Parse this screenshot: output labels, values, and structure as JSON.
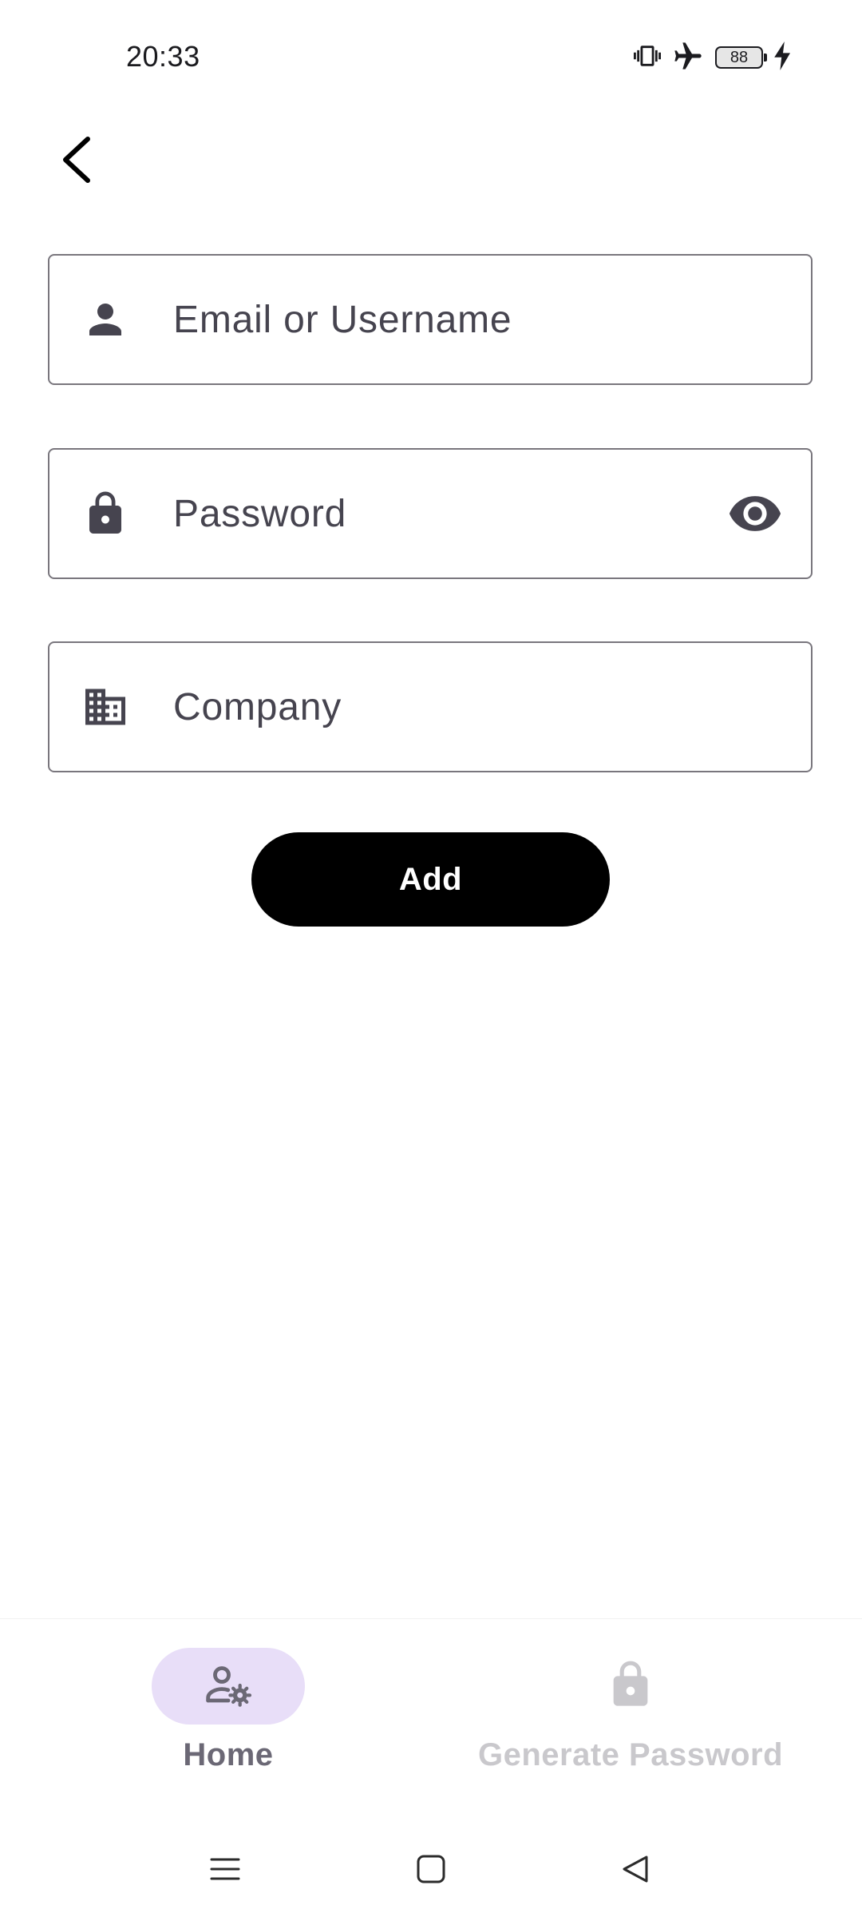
{
  "status_bar": {
    "time": "20:33",
    "battery_level": "88",
    "icons": [
      "vibrate-icon",
      "airplane-icon",
      "battery-icon",
      "charging-icon"
    ]
  },
  "header": {
    "back_icon": "chevron-left-icon"
  },
  "form": {
    "email": {
      "placeholder": "Email or Username",
      "value": "",
      "icon": "person-icon"
    },
    "password": {
      "placeholder": "Password",
      "value": "",
      "icon": "lock-icon",
      "toggle_icon": "eye-icon"
    },
    "company": {
      "placeholder": "Company",
      "value": "",
      "icon": "building-icon"
    },
    "submit_label": "Add"
  },
  "bottom_nav": {
    "items": [
      {
        "label": "Home",
        "icon": "user-settings-icon",
        "selected": true
      },
      {
        "label": "Generate Password",
        "icon": "lock-icon",
        "selected": false
      }
    ]
  },
  "system_nav": {
    "icons": [
      "menu-icon",
      "home-square-icon",
      "back-triangle-icon"
    ]
  },
  "colors": {
    "nav_pill": "#e8def8",
    "button_bg": "#000000",
    "field_border": "#79767d",
    "icon": "#46444f"
  }
}
